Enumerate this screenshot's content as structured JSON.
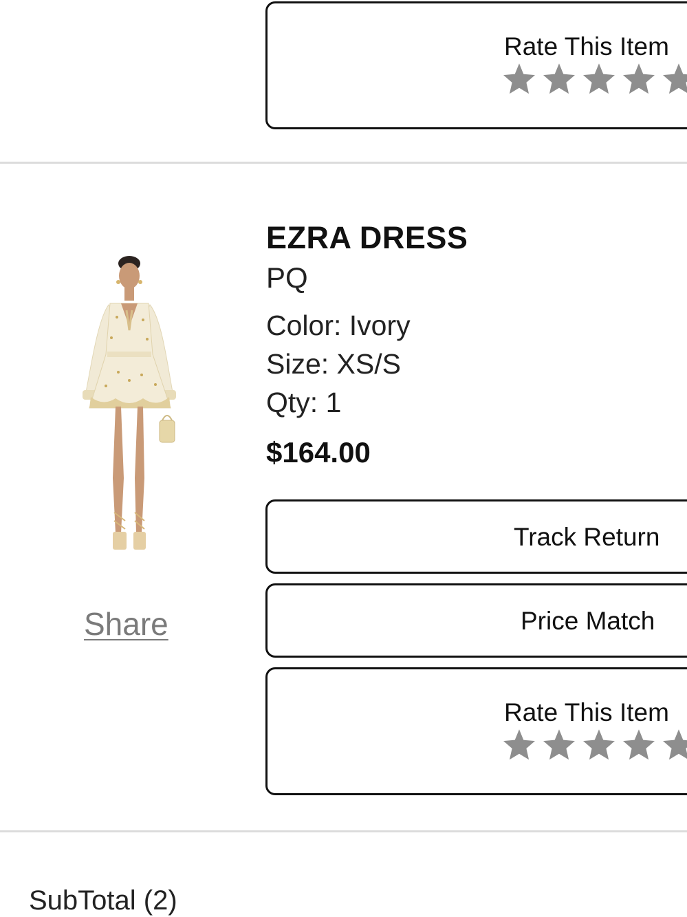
{
  "top_item": {
    "rate_label": "Rate This Item",
    "stars": 0
  },
  "item": {
    "title": "EZRA DRESS",
    "brand": "PQ",
    "color": "Color: Ivory",
    "size": "Size: XS/S",
    "qty": "Qty: 1",
    "price": "$164.00",
    "share_label": "Share",
    "track_return_label": "Track Return",
    "price_match_label": "Price Match",
    "rate_label": "Rate This Item",
    "stars": 0,
    "image_icon": "dress-product-photo"
  },
  "summary": {
    "subtotal_label": "SubTotal (2)"
  },
  "colors": {
    "star_inactive": "#8e8e8e",
    "border": "#111111",
    "divider": "#dcdcdc",
    "share_link": "#7a7a7a"
  }
}
